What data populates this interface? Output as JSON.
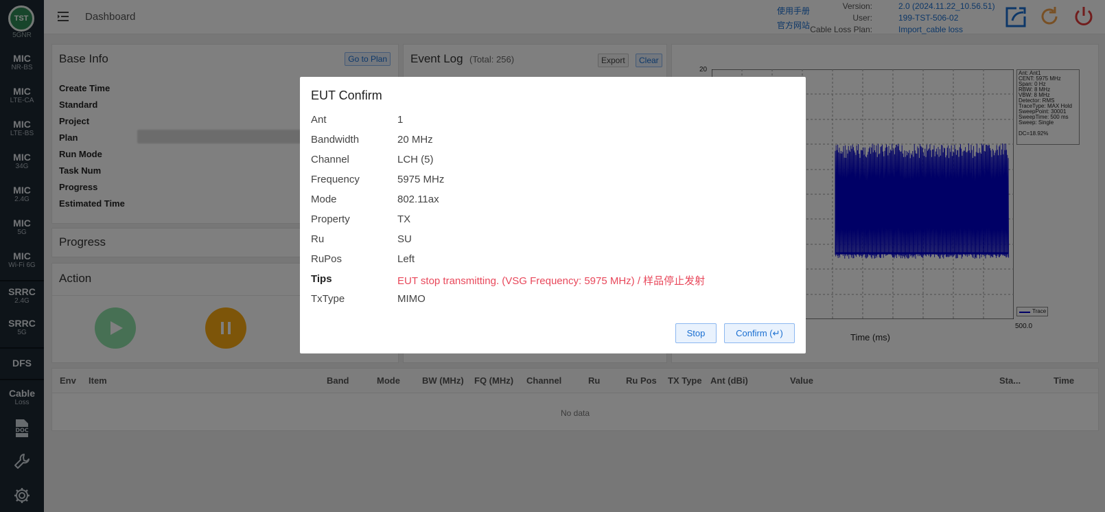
{
  "sidebar": {
    "logo_text": "TST",
    "top_fragment": "5GNR",
    "items": [
      {
        "title": "MIC",
        "sub": "NR-BS"
      },
      {
        "title": "MIC",
        "sub": "LTE-CA"
      },
      {
        "title": "MIC",
        "sub": "LTE-BS"
      },
      {
        "title": "MIC",
        "sub": "34G"
      },
      {
        "title": "MIC",
        "sub": "2.4G"
      },
      {
        "title": "MIC",
        "sub": "5G"
      },
      {
        "title": "MIC",
        "sub": "Wi-Fi 6G"
      },
      {
        "title": "SRRC",
        "sub": "2.4G"
      },
      {
        "title": "SRRC",
        "sub": "5G"
      },
      {
        "title": "DFS",
        "sub": ""
      },
      {
        "title": "Cable",
        "sub": "Loss"
      }
    ],
    "icons": [
      "doc-icon",
      "wrench-icon",
      "gear-icon"
    ],
    "doc_icon_text": "DOC"
  },
  "header": {
    "title": "Dashboard",
    "manual_link": "使用手册",
    "website_link": "官方网站",
    "version_label": "Version:",
    "version_value": "2.0 (2024.11.22_10.56.51)",
    "user_label": "User:",
    "user_value": "199-TST-506-02",
    "cable_label": "Cable Loss Plan:",
    "cable_value": "Import_cable loss"
  },
  "base_info": {
    "title": "Base Info",
    "go_to_plan": "Go to Plan",
    "labels": [
      "Create Time",
      "Standard",
      "Project",
      "Plan",
      "Run Mode",
      "Task Num",
      "Progress",
      "Estimated Time"
    ]
  },
  "event_log": {
    "title": "Event Log",
    "total": "(Total: 256)",
    "export": "Export",
    "clear": "Clear"
  },
  "progress": {
    "title": "Progress"
  },
  "action": {
    "title": "Action"
  },
  "spectrum": {
    "y_top": "20",
    "x_end": "500.0",
    "x_label": "Time (ms)",
    "legend": "Trace",
    "info_lines": [
      "Ant: Ant1",
      "CENT: 5975 MHz",
      "Span: 0 Hz",
      "RBW: 8 MHz",
      "VBW: 8 MHz",
      "Detector: RMS",
      "TraceType: MAX Hold",
      "SweepPoint: 30001",
      "SweepTime: 500 ms",
      "Sweep: Single"
    ],
    "dc": "DC=18.92%",
    "trace_color": "#0000cc"
  },
  "table": {
    "headers": [
      "Env",
      "Item",
      "Band",
      "Mode",
      "BW (MHz)",
      "FQ (MHz)",
      "Channel",
      "Ru",
      "Ru Pos",
      "TX Type",
      "Ant (dBi)",
      "Value",
      "Sta...",
      "Time"
    ],
    "empty": "No data"
  },
  "dialog": {
    "title": "EUT Confirm",
    "rows": [
      {
        "k": "Ant",
        "v": "1"
      },
      {
        "k": "Bandwidth",
        "v": "20 MHz"
      },
      {
        "k": "Channel",
        "v": "LCH (5)"
      },
      {
        "k": "Frequency",
        "v": "5975 MHz"
      },
      {
        "k": "Mode",
        "v": "802.11ax"
      },
      {
        "k": "Property",
        "v": "TX"
      },
      {
        "k": "Ru",
        "v": "SU"
      },
      {
        "k": "RuPos",
        "v": "Left"
      },
      {
        "k": "Tips",
        "v": "EUT stop transmitting. (VSG Frequency: 5975 MHz) / 样品停止发射"
      },
      {
        "k": "TxType",
        "v": "MIMO"
      }
    ],
    "stop": "Stop",
    "confirm": "Confirm (↵)",
    "tips_color": "#e8475a"
  }
}
